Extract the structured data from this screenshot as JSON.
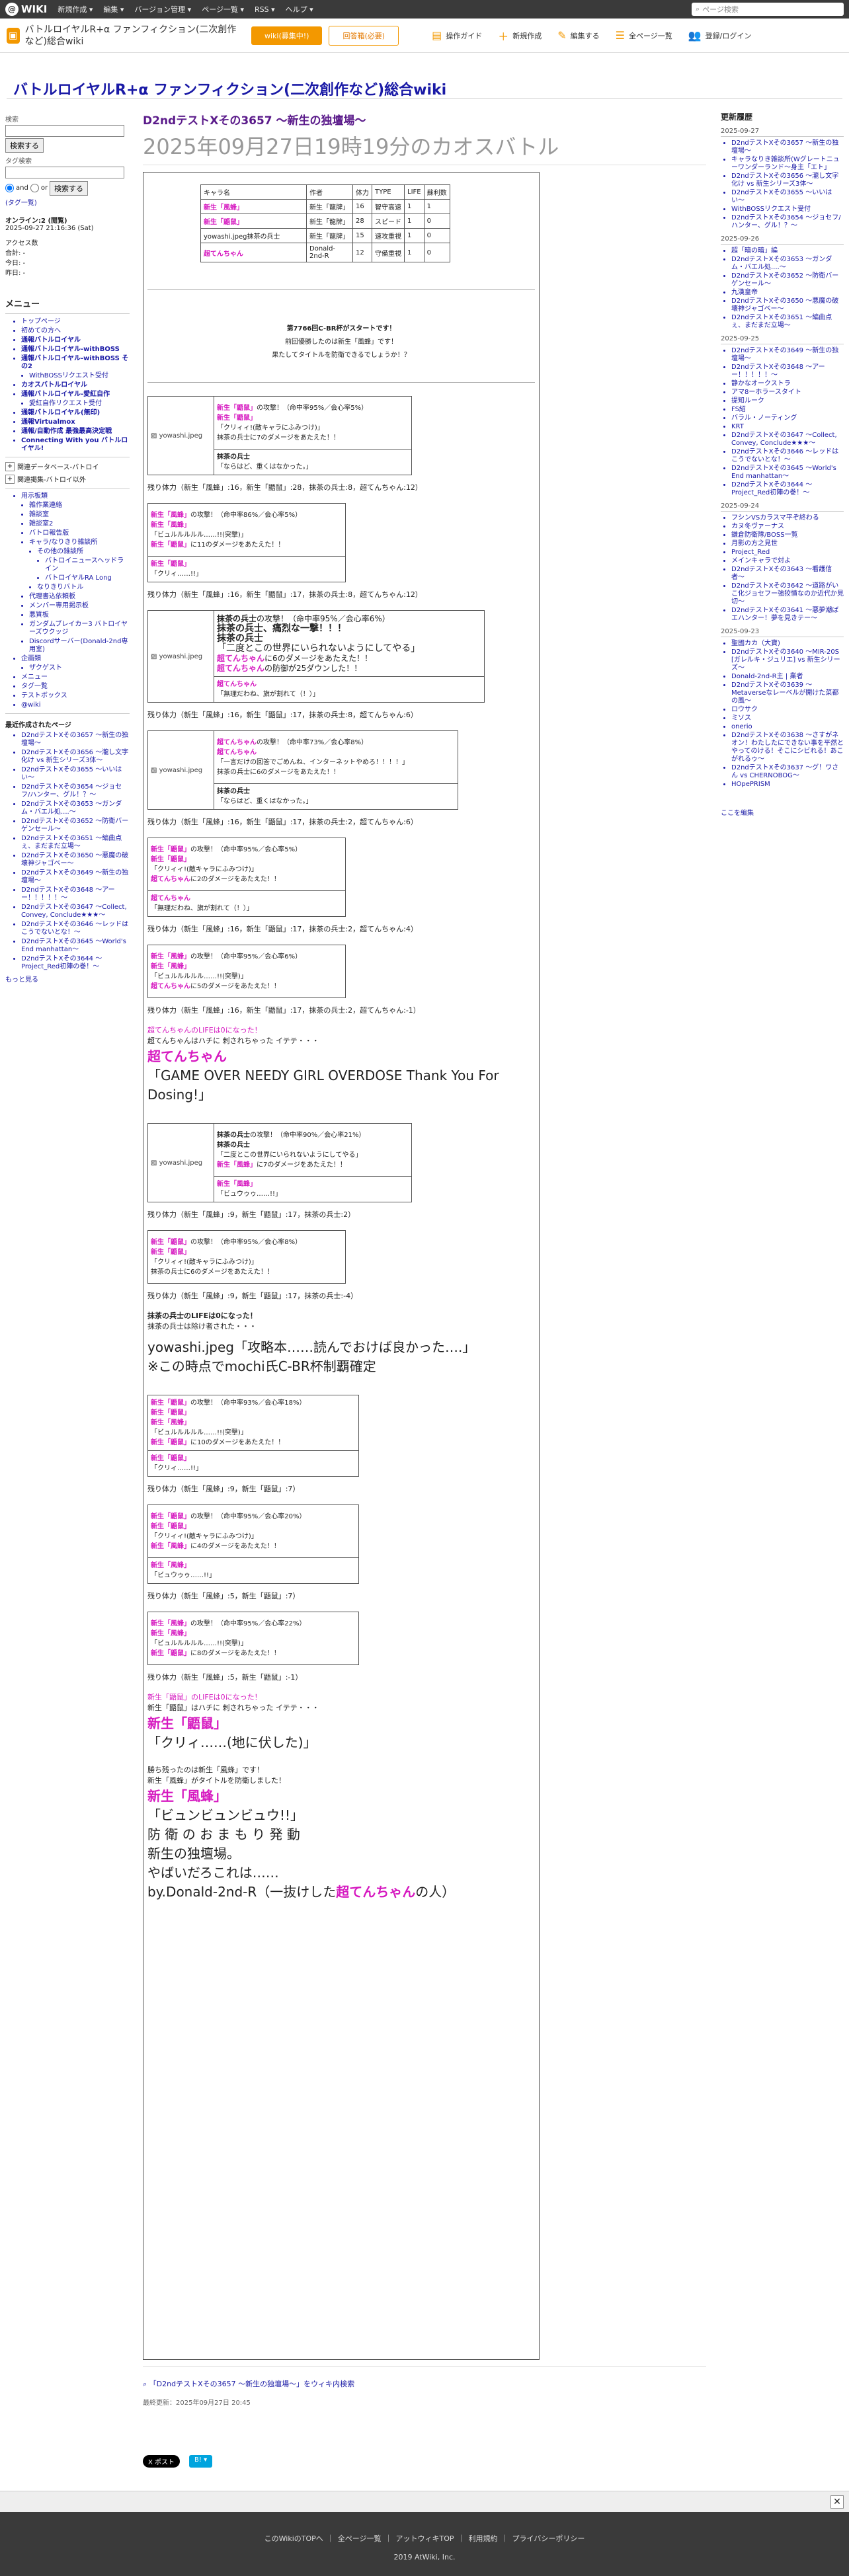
{
  "topbar": {
    "logo": "WIKI",
    "menus": [
      "新規作成 ▾",
      "編集 ▾",
      "バージョン管理 ▾",
      "ページ一覧 ▾",
      "RSS ▾",
      "ヘルプ ▾"
    ],
    "search_placeholder": "ページ検索"
  },
  "toolbar": {
    "wiki_name": "バトルロイヤルR+α ファンフィクション(二次創作など)総合wiki",
    "btn1": "wiki(募集中!)",
    "btn2": "回答箱(必要)",
    "tools": [
      "操作ガイド",
      "新規作成",
      "編集する",
      "全ページ一覧",
      "登録/ログイン"
    ]
  },
  "site_title": "バトルロイヤルR+α ファンフィクション(二次創作など)総合wiki",
  "left": {
    "search_label": "検索",
    "search_btn": "検索する",
    "tag_label": "タグ検索",
    "and": "and",
    "or": "or",
    "search_btn2": "検索する",
    "tag_list": "(タグ一覧)",
    "online_label": "オンライン:2 (閲覧)",
    "online_time": "2025-09-27 21:16:36 (Sat)",
    "access_label": "アクセス数",
    "access_total": "合計: -",
    "access_today": "今日: -",
    "access_yesterday": "昨日: -",
    "menu_title": "メニュー",
    "menu_items": [
      "トップページ",
      "初めての方へ",
      "通報バトルロイヤル",
      "通報バトルロイヤル-withBOSS",
      "通報バトルロイヤル-withBOSS その2",
      "WithBOSSリクエスト受付",
      "カオスバトルロイヤル",
      "通報バトルロイヤル-愛紅自作",
      "愛紅自作リクエスト受付",
      "通報バトルロイヤル(無印)",
      "通報Virtualmox",
      "通報/自動作成 最強最高決定戦",
      "Connecting With you バトルロイヤル!"
    ],
    "collapse1": "関連データベース-バトロイ",
    "collapse2": "関連掲集-バトロイ以外",
    "sub_items": [
      "用示板類",
      "雑作業連絡",
      "雑談室",
      "雑談室2",
      "バトロ報告版",
      "キャラ/なりきり雑談所",
      "その他の雑談所",
      "バトロイニュースヘッドライン",
      "バトロイヤルRA Long",
      "なりきりバトル",
      "代理書込依頼板",
      "メンバー専用掲示板",
      "悪質板",
      "ガンダムブレイカー3 バトロイヤーズウクッジ",
      "Discordサーバー(Donald-2nd専用室)",
      "企画類",
      "ザクゲスト",
      "メニュー",
      "タグ一覧",
      "テストボックス",
      "@wiki"
    ],
    "recent_title": "最近作成されたページ",
    "recent": [
      "D2ndテストXその3657 〜新生の独壇場〜",
      "D2ndテストXその3656 〜瀧し文字化け vs 新生シリーズ3体〜",
      "D2ndテストXその3655 〜いいはい〜",
      "D2ndテストXその3654 〜ジョセフ/ハンター、グル！？〜",
      "D2ndテストXその3653 〜ガンダム・バエル処....〜",
      "D2ndテストXその3652 〜防衛バーゲンセール〜",
      "D2ndテストXその3651 〜編曲点ぇ、まだまだ立場〜",
      "D2ndテストXその3650 〜悪魔の破壊神ジャゴベー〜",
      "D2ndテストXその3649 〜新生の独壇場〜",
      "D2ndテストXその3648 〜アーー！！！！！〜",
      "D2ndテストXその3647 〜Collect, Convey, Conclude★★★〜",
      "D2ndテストXその3646 〜レッドはこうでないとな！〜",
      "D2ndテストXその3645 〜World's End manhattan〜",
      "D2ndテストXその3644 〜Project_Red初陣の巻！〜"
    ],
    "more": "もっと見る"
  },
  "main": {
    "page_title": "D2ndテストXその3657 〜新生の独壇場〜",
    "subtitle": "2025年09月27日19時19分のカオスバトル",
    "chars_header": [
      "キャラ名",
      "作者",
      "体力",
      "TYPE",
      "LIFE",
      "蘇利数"
    ],
    "chars": [
      [
        "新生「風蜂」",
        "新生「龍牌」",
        "16",
        "智守高速",
        "1",
        "1"
      ],
      [
        "新生「鼯鼠」",
        "新生「龍牌」",
        "28",
        "スピード",
        "1",
        "0"
      ],
      [
        "yowashi.jpeg抹茶の兵士",
        "新生「龍牌」",
        "15",
        "速攻重視",
        "1",
        "0"
      ],
      [
        "超てんちゃん",
        "Donald-2nd-R",
        "12",
        "守備重視",
        "1",
        "0"
      ]
    ],
    "intro1": "第7766回C-BR杯がスタートです！",
    "intro2": "前回優勝したのは新生「風蜂」です！",
    "intro3": "果たしてタイトルを防衛できるでしょうか！？",
    "hp1": "残り体力（新生「風蜂」:16，新生「鼯鼠」:28，抹茶の兵士:8，超てんちゃん:12）",
    "hp2": "残り体力（新生「風蜂」:16，新生「鼯鼠」:17，抹茶の兵士:8，超てんちゃん:12）",
    "hp3": "残り体力（新生「風蜂」:16，新生「鼯鼠」:17，抹茶の兵士:8，超てんちゃん:6）",
    "hp4": "残り体力（新生「風蜂」:16，新生「鼯鼠」:17，抹茶の兵士:2，超てんちゃん:6）",
    "hp5": "残り体力（新生「風蜂」:16，新生「鼯鼠」:17，抹茶の兵士:2，超てんちゃん:4）",
    "hp6": "残り体力（新生「風蜂」:16，新生「鼯鼠」:17，抹茶の兵士:2，超てんちゃん:-1）",
    "ko1a": "超てんちゃんのLIFEは0になった！",
    "ko1b": "超てんちゃんはハチに 刺されちゃった イテテ・・・",
    "ko1name": "超てんちゃん",
    "ko1quote": "「GAME OVER NEEDY GIRL OVERDOSE Thank You For Dosing!」",
    "hp7": "残り体力（新生「風蜂」:9，新生「鼯鼠」:17，抹茶の兵士:2）",
    "hp8": "残り体力（新生「風蜂」:9，新生「鼯鼠」:17，抹茶の兵士:-4）",
    "ko2a": "抹茶の兵士のLIFEは0になった！",
    "ko2b": "抹茶の兵士は除け者された・・・",
    "ko2quote": "yowashi.jpeg「攻略本……読んでおけば良かった….」",
    "ko2note": "※この時点でmochi氏C-BR杯制覇確定",
    "hp9": "残り体力（新生「風蜂」:9，新生「鼯鼠」:7）",
    "hp10": "残り体力（新生「風蜂」:5，新生「鼯鼠」:7）",
    "hp11": "残り体力（新生「風蜂」:5，新生「鼯鼠」:-1）",
    "ko3a": "新生「鼯鼠」のLIFEは0になった！",
    "ko3b": "新生「鼯鼠」はハチに 刺されちゃった イテテ・・・",
    "ko3name": "新生「鼯鼠」",
    "ko3quote": "「クリィ……(地に伏した)」",
    "win1": "勝ち残ったのは新生「風蜂」です！",
    "win2": "新生「風蜂」がタイトルを防衛しました！",
    "winname": "新生「風蜂」",
    "winquote": "「ビュンビュンビュウ!!」",
    "win3": "防 衛 の お ま も り 発 動",
    "win4": "新生の独壇場。",
    "win5": "やばいだろこれは……",
    "win6a": "by.Donald-2nd-R（一抜けした",
    "win6b": "超てんちゃん",
    "win6c": "の人）",
    "share": "「D2ndテストXその3657 〜新生の独壇場〜」をウィキ内検索",
    "updated": "最終更新：2025年09月27日 20:45",
    "tweet": "X ポスト",
    "hatena": "B! ▾"
  },
  "right": {
    "title": "更新履歴",
    "edit": "ここを編集",
    "groups": [
      {
        "date": "2025-09-27",
        "items": [
          "D2ndテストXその3657 〜新生の独壇場〜",
          "キャラなりき雑談所(Wグレートニューワンダーランド〜身主「エト」",
          "D2ndテストXその3656 〜瀧し文字化け vs 新生シリーズ3体〜",
          "D2ndテストXその3655 〜いいはい〜",
          "WithBOSSリクエスト受付",
          "D2ndテストXその3654 〜ジョセフ/ハンター、グル！？〜"
        ]
      },
      {
        "date": "2025-09-26",
        "items": [
          "超「暗の暗」編",
          "D2ndテストXその3653 〜ガンダム・バエル処....〜",
          "D2ndテストXその3652 〜防衛バーゲンセール〜",
          "九漢皇帝",
          "D2ndテストXその3650 〜悪魔の破壊神ジャゴベー〜",
          "D2ndテストXその3651 〜編曲点ぇ、まだまだ立場〜"
        ]
      },
      {
        "date": "2025-09-25",
        "items": [
          "D2ndテストXその3649 〜新生の独壇場〜",
          "D2ndテストXその3648 〜アーー！！！！！〜",
          "静かなオークストラ",
          "アマ8ーホラースタイト",
          "提知ルーク",
          "FS紹",
          "バラル・ノーティング",
          "KRT",
          "D2ndテストXその3647 〜Collect, Convey, Conclude★★★〜",
          "D2ndテストXその3646 〜レッドはこうでないとな！〜",
          "D2ndテストXその3645 〜World's End manhattan〜",
          "D2ndテストXその3644 〜Project_Red初陣の巻！〜"
        ]
      },
      {
        "date": "2025-09-24",
        "items": [
          "フシンVSカラスマ平ぞ終わる",
          "カヌ冬ヴァーナス",
          "鎌倉防衛隊/BOSS一覧",
          "月影の方之見世",
          "Project_Red",
          "メインキャラで対よ",
          "D2ndテストXその3643 〜看護信者〜",
          "D2ndテストXその3642 〜道路がいこ化ジョセフー強狡憤なのか近代か見切〜",
          "D2ndテストXその3641 〜悪夢潮ばエハンター！夢を見きテー〜"
        ]
      },
      {
        "date": "2025-09-23",
        "items": [
          "聖國カカ（大寶)",
          "D2ndテストXその3640 〜MIR-20S [ガレルキ・ジュリエ] vs 新生シリーズ〜",
          "Donald-2nd-R主 | 業者",
          "D2ndテストXその3639 〜Metaverseなレーベルが開けた菜都の風〜",
          "ロウサク",
          "ミソス",
          "onerio",
          "D2ndテストXその3638 〜さすがネオン！わたしたにできない事を平然とやってのける！そこにシビれる！あこがれるゥ〜",
          "D2ndテストXその3637 〜グ！ワさん vs CHERNOBOG〜",
          "HOpePRISM"
        ]
      }
    ]
  },
  "footer": {
    "links": "このWikiのTOPへ ｜ 全ページ一覧 ｜ アットウィキTOP ｜ 利用規約 ｜ プライバシーポリシー",
    "copy": "2019 AtWiki, Inc."
  }
}
